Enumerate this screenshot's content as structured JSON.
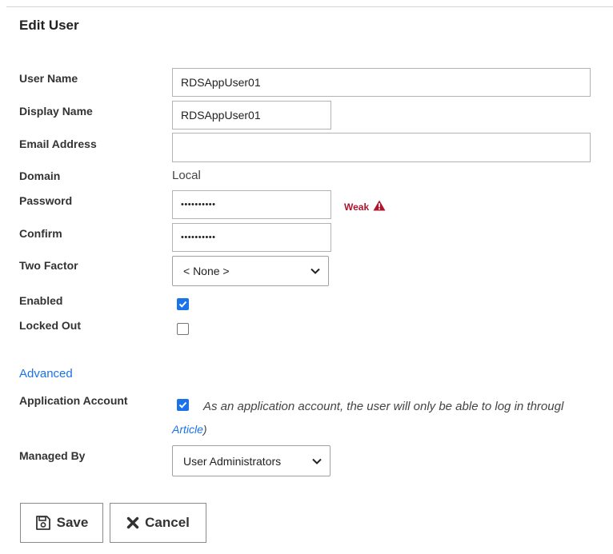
{
  "title": "Edit User",
  "fields": {
    "user_name": {
      "label": "User Name",
      "value": "RDSAppUser01"
    },
    "display_name": {
      "label": "Display Name",
      "value": "RDSAppUser01"
    },
    "email_address": {
      "label": "Email Address",
      "value": ""
    },
    "domain": {
      "label": "Domain",
      "value": "Local"
    },
    "password": {
      "label": "Password",
      "value": "••••••••••",
      "strength": "Weak"
    },
    "confirm": {
      "label": "Confirm",
      "value": "••••••••••"
    },
    "two_factor": {
      "label": "Two Factor",
      "selected": "< None >"
    },
    "enabled": {
      "label": "Enabled",
      "checked": true
    },
    "locked_out": {
      "label": "Locked Out",
      "checked": false
    }
  },
  "advanced": {
    "link_label": "Advanced",
    "application_account": {
      "label": "Application Account",
      "checked": true,
      "note": "As an application account, the user will only be able to log in througl",
      "article_link": "Article",
      "article_suffix": ")"
    },
    "managed_by": {
      "label": "Managed By",
      "selected": "User Administrators"
    }
  },
  "buttons": {
    "save": "Save",
    "cancel": "Cancel"
  },
  "colors": {
    "accent": "#1a73e8",
    "warning": "#b3122b",
    "border": "#b3b3b3"
  },
  "icons": {
    "warning": "warning-triangle-icon",
    "save": "floppy-disk-icon",
    "cancel": "x-icon",
    "dropdown": "chevron-down-icon",
    "check": "check-icon"
  }
}
